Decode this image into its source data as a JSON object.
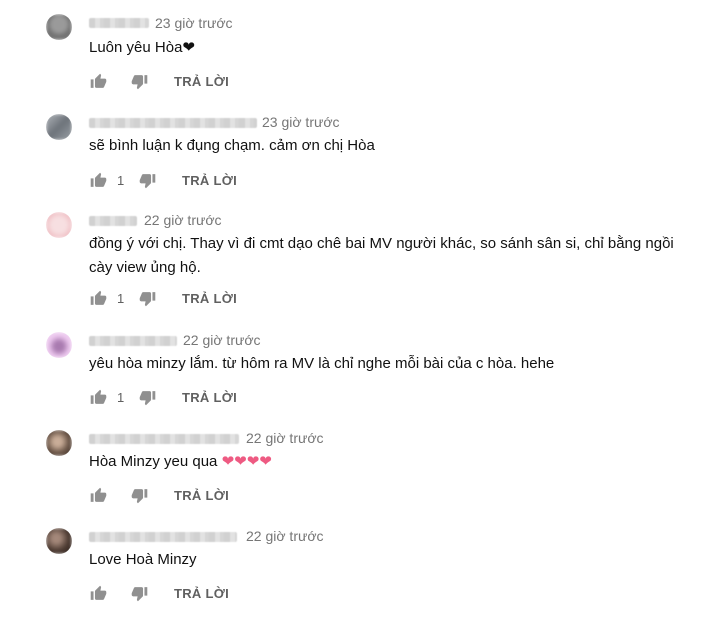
{
  "comments": [
    {
      "timestamp": "23 giờ trước",
      "text": "Luôn yêu Hòa",
      "text_emoji": "❤",
      "likes": "",
      "reply_label": "TRẢ LỜI",
      "avatar_color": "#7a7a7a"
    },
    {
      "timestamp": "23 giờ trước",
      "text": "sẽ bình luận k đụng chạm. cảm ơn chị Hòa",
      "likes": "1",
      "reply_label": "TRẢ LỜI",
      "avatar_color": "#8a8f95"
    },
    {
      "timestamp": "22 giờ trước",
      "text": "đồng ý với chị. Thay vì đi cmt dạo chê bai MV người khác, so sánh sân si, chỉ bằng ngồi\ncày view ủng hộ.",
      "likes": "1",
      "reply_label": "TRẢ LỜI",
      "avatar_color": "#f2c9cd"
    },
    {
      "timestamp": "22 giờ trước",
      "text": "yêu hòa minzy lắm. từ hôm ra MV là chỉ nghe mỗi bài của c hòa. hehe",
      "likes": "1",
      "reply_label": "TRẢ LỜI",
      "avatar_color": "#e9c3ec"
    },
    {
      "timestamp": "22 giờ trước",
      "text": "Hòa Minzy yeu qua ",
      "text_emoji": "❤❤❤❤",
      "likes": "",
      "reply_label": "TRẢ LỜI",
      "avatar_color": "#6b5648"
    },
    {
      "timestamp": "22 giờ trước",
      "text": "Love Hoà Minzy",
      "likes": "",
      "reply_label": "TRẢ LỜI",
      "avatar_color": "#4e3c33"
    }
  ],
  "colors": {
    "text": "#111111",
    "meta": "#767676",
    "action": "#606060",
    "heart_pink": "#ee5a82"
  },
  "icons": {
    "like": "thumbs-up-icon",
    "dislike": "thumbs-down-icon"
  }
}
